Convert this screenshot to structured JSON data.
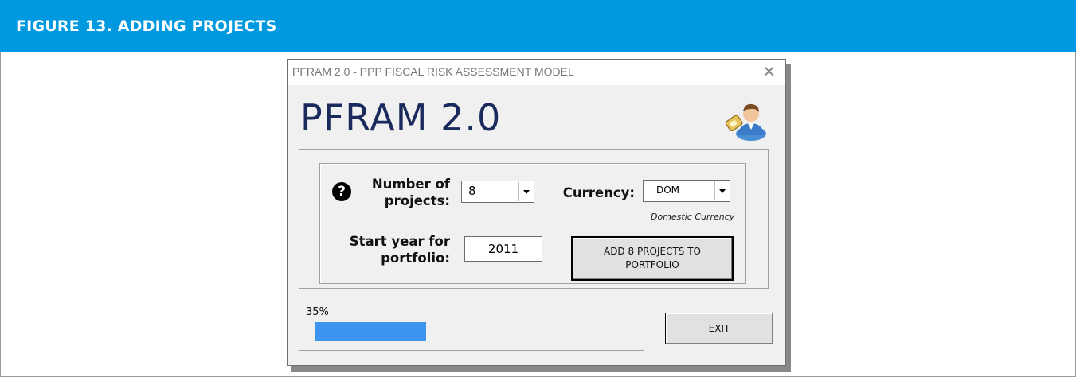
{
  "figure": {
    "title": "FIGURE 13. ADDING PROJECTS"
  },
  "dialog": {
    "window_title": "PFRAM 2.0 - PPP FISCAL RISK ASSESSMENT MODEL",
    "close_glyph": "✕",
    "app_title": "PFRAM 2.0",
    "icons": {
      "user": "user-key-icon",
      "help": "help-icon"
    },
    "help_glyph": "?",
    "fields": {
      "num_projects_label_l1": "Number of",
      "num_projects_label_l2": "projects:",
      "num_projects_value": "8",
      "currency_label": "Currency:",
      "currency_value": "DOM",
      "currency_caption": "Domestic Currency",
      "start_year_label_l1": "Start year for",
      "start_year_label_l2": "portfolio:",
      "start_year_value": "2011"
    },
    "add_button_label": "ADD 8 PROJECTS TO PORTFOLIO",
    "progress": {
      "label": "35%",
      "value": 0.35
    },
    "exit_button_label": "EXIT",
    "colors": {
      "header": "#0099e0",
      "progress": "#3d95f0",
      "title_text": "#1a2a5c"
    }
  }
}
